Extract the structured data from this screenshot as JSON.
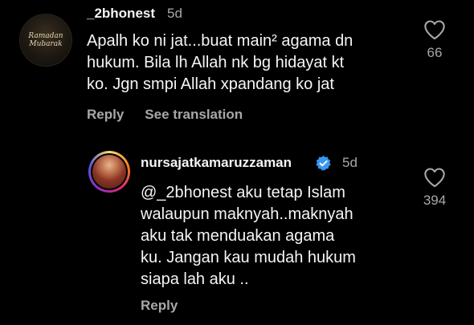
{
  "comments": [
    {
      "avatar_text": "Ramadan\nMubarak",
      "username": "_2bhonest",
      "time": "5d",
      "body": "Apalh ko ni jat...buat main² agama dn\nhukum. Bila lh Allah nk bg hidayat kt\nko. Jgn smpi Allah xpandang ko jat",
      "reply_label": "Reply",
      "translation_label": "See translation",
      "likes": "66"
    },
    {
      "username": "nursajatkamaruzzaman",
      "verified": true,
      "time": "5d",
      "body": "@_2bhonest aku tetap Islam\nwalaupun maknyah..maknyah\naku tak menduakan agama\nku. Jangan kau mudah hukum\nsiapa lah aku ..",
      "reply_label": "Reply",
      "likes": "394"
    }
  ],
  "colors": {
    "background": "#000000",
    "primary_text": "#f5f5f5",
    "secondary_text": "#a8a8a8",
    "verified_badge": "#3897f0"
  }
}
